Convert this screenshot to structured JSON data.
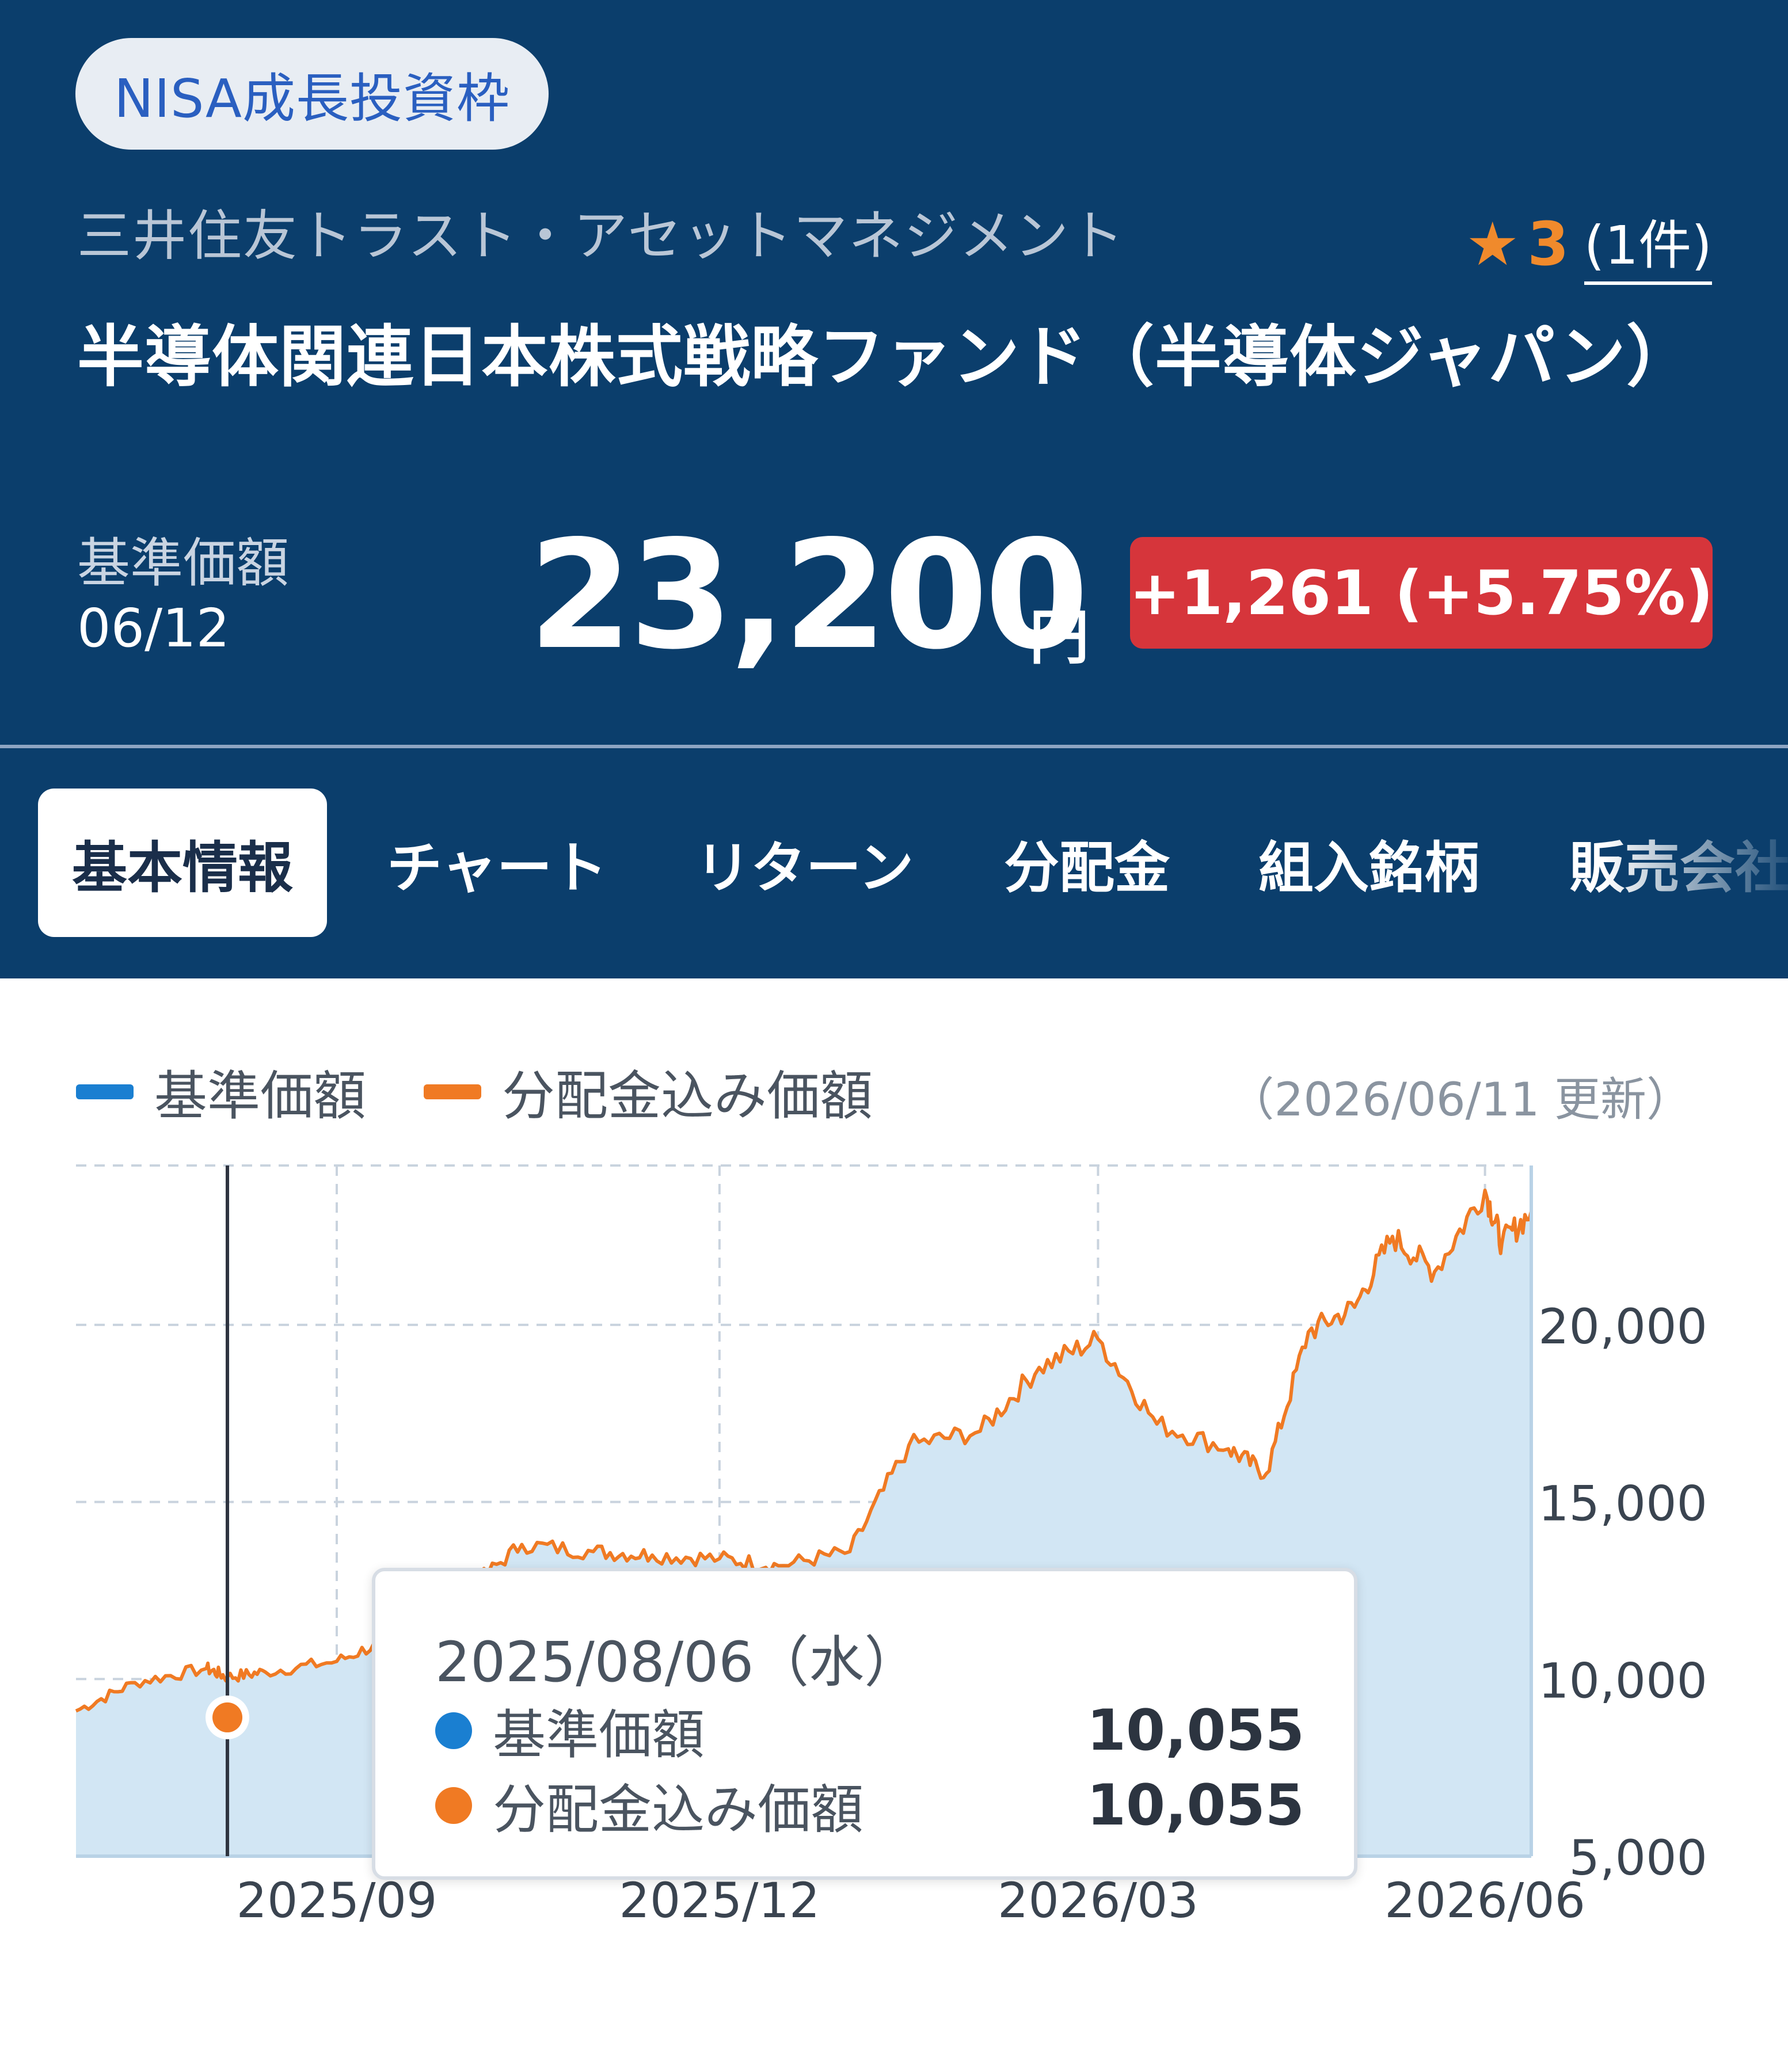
{
  "header": {
    "badge": "NISA成長投資枠",
    "company": "三井住友トラスト・アセットマネジメント",
    "rating": {
      "score": "3",
      "count": "(1件)"
    },
    "fund_name": "半導体関連日本株式戦略ファンド（半導体ジャパン）",
    "nav_label": "基準価額",
    "nav_date": "06/12",
    "price": "23,200",
    "price_unit": "円",
    "change": "+1,261 (+5.75%)"
  },
  "tabs": [
    "基本情報",
    "チャート",
    "リターン",
    "分配金",
    "組入銘柄",
    "販売会社"
  ],
  "legend": {
    "nav": "基準価額",
    "dist": "分配金込み価額",
    "updated": "（2026/06/11 更新）"
  },
  "colors": {
    "navy": "#0b3e6c",
    "nav_line": "#1a7fd1",
    "dist_line": "#f07a23",
    "area": "#d2e6f4",
    "change_bg": "#d6353b"
  },
  "tooltip": {
    "date": "2025/08/06（水）",
    "rows": [
      {
        "label": "基準価額",
        "value": "10,055"
      },
      {
        "label": "分配金込み価額",
        "value": "10,055"
      }
    ]
  },
  "chart_data": {
    "type": "area",
    "series": [
      {
        "name": "基準価額"
      },
      {
        "name": "分配金込み価額"
      }
    ],
    "x": [
      "2025-07-01",
      "2025-07-15",
      "2025-08-01",
      "2025-08-06",
      "2025-08-15",
      "2025-09-01",
      "2025-09-15",
      "2025-10-01",
      "2025-10-15",
      "2025-11-01",
      "2025-11-15",
      "2025-12-01",
      "2025-12-15",
      "2026-01-01",
      "2026-01-15",
      "2026-02-01",
      "2026-02-15",
      "2026-03-01",
      "2026-03-15",
      "2026-04-01",
      "2026-04-10",
      "2026-04-20",
      "2026-05-01",
      "2026-05-10",
      "2026-05-20",
      "2026-06-01",
      "2026-06-05",
      "2026-06-12"
    ],
    "values": [
      9100,
      9900,
      10300,
      10055,
      10200,
      10500,
      11200,
      12400,
      13800,
      13600,
      13500,
      13400,
      13200,
      13600,
      16600,
      17000,
      18800,
      19600,
      17200,
      16500,
      15800,
      19800,
      20500,
      22500,
      21500,
      23800,
      22300,
      23200
    ],
    "x_ticks": [
      "2025/09",
      "2025/12",
      "2026/03",
      "2026/06"
    ],
    "y_ticks": [
      "5,000",
      "10,000",
      "15,000",
      "20,000"
    ],
    "ylim": [
      5000,
      24500
    ],
    "grid": true,
    "legend": "top-left"
  }
}
